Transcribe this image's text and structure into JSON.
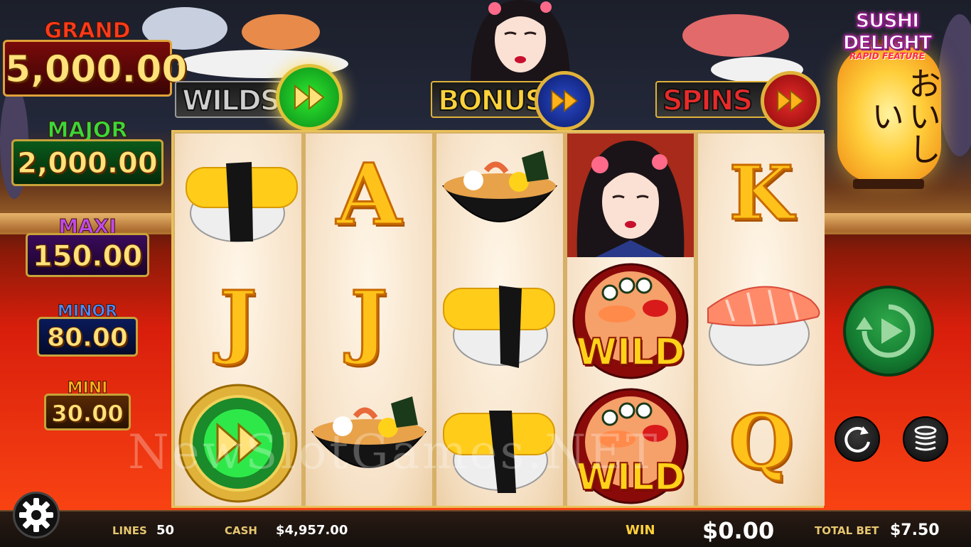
{
  "game": {
    "title": "SUSHI DELIGHT",
    "subtitle": "RAPID FEATURE",
    "lantern_text": "おいしい"
  },
  "jackpots": [
    {
      "name": "GRAND",
      "value": "5,000.00",
      "color": "#e32a1a"
    },
    {
      "name": "MAJOR",
      "value": "2,000.00",
      "color": "#2aa82a"
    },
    {
      "name": "MAXI",
      "value": "150.00",
      "color": "#a22ad8"
    },
    {
      "name": "MINOR",
      "value": "80.00",
      "color": "#2a6ad8"
    },
    {
      "name": "MINI",
      "value": "30.00",
      "color": "#e3a21a"
    }
  ],
  "features": [
    {
      "label": "WILDS",
      "active": true,
      "accent": "#2ab82a"
    },
    {
      "label": "BONUS",
      "active": false,
      "accent": "#1a3aa8"
    },
    {
      "label": "SPINS",
      "active": false,
      "accent": "#c81a1a"
    }
  ],
  "reels": [
    [
      "tamago-sushi",
      "J",
      "rapid-coin"
    ],
    [
      "A",
      "J",
      "ramen-bowl"
    ],
    [
      "ramen-bowl",
      "tamago-sushi",
      "tamago-sushi"
    ],
    [
      "geisha",
      "wild",
      "wild"
    ],
    [
      "K",
      "salmon-sushi",
      "Q"
    ]
  ],
  "symbols": {
    "wild_label": "WILD"
  },
  "bottom_bar": {
    "lines_label": "LINES",
    "lines_value": "50",
    "cash_label": "CASH",
    "cash_value": "$4,957.00",
    "win_label": "WIN",
    "win_value": "$0.00",
    "total_bet_label": "TOTAL BET",
    "total_bet_value": "$7.50"
  },
  "watermark": "NewSlotGames.NET",
  "icons": [
    "gear-icon",
    "spin-icon",
    "autoplay-icon",
    "coins-icon",
    "fast-forward-icon"
  ]
}
